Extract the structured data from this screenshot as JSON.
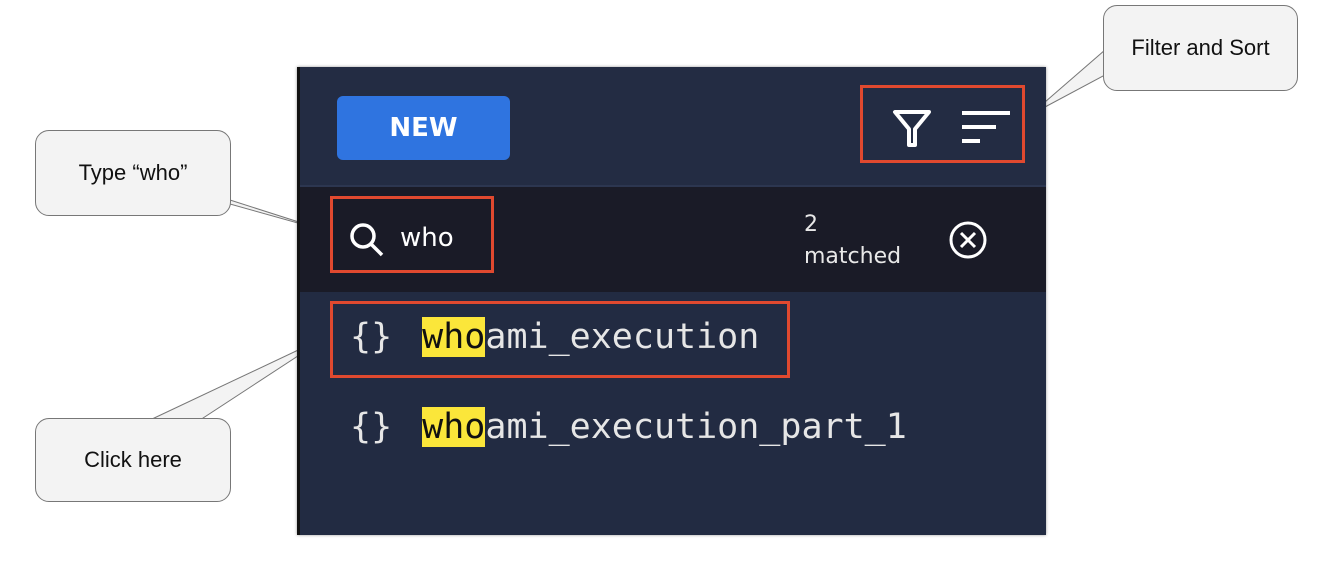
{
  "panel": {
    "new_button": "NEW",
    "filter_icon": "filter-icon",
    "sort_icon": "sort-icon",
    "search": {
      "value": "who",
      "match_count": "2",
      "match_label": "matched"
    },
    "items": [
      {
        "highlight": "who",
        "rest": "ami_execution",
        "icon": "braces-icon"
      },
      {
        "highlight": "who",
        "rest": "ami_execution_part_1",
        "icon": "braces-icon"
      }
    ]
  },
  "callouts": {
    "type_who": "Type “who”",
    "filter_sort": "Filter and Sort",
    "click_here": "Click here"
  },
  "colors": {
    "accent": "#2f74e0",
    "highlight": "#fbe63a",
    "annotation": "#e0492f"
  }
}
